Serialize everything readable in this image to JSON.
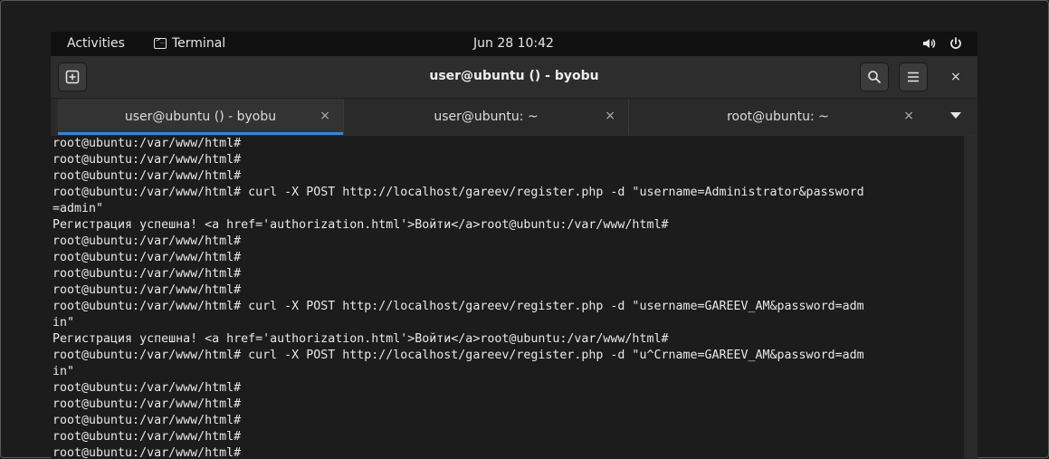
{
  "topbar": {
    "activities": "Activities",
    "app_name": "Terminal",
    "clock": "Jun 28  10:42",
    "icons": {
      "app": "terminal-icon",
      "volume": "volume-icon",
      "power": "power-icon"
    }
  },
  "window": {
    "title": "user@ubuntu () - byobu",
    "buttons": {
      "new_tab": "new-tab-icon",
      "search": "search-icon",
      "menu": "hamburger-menu-icon",
      "close": "×"
    }
  },
  "tabs": [
    {
      "label": "user@ubuntu () - byobu",
      "close": "×",
      "active": true
    },
    {
      "label": "user@ubuntu: ~",
      "close": "×",
      "active": false
    },
    {
      "label": "root@ubuntu: ~",
      "close": "×",
      "active": false
    }
  ],
  "terminal": {
    "lines": [
      "root@ubuntu:/var/www/html#",
      "root@ubuntu:/var/www/html#",
      "root@ubuntu:/var/www/html#",
      "root@ubuntu:/var/www/html# curl -X POST http://localhost/gareev/register.php -d \"username=Administrator&password",
      "=admin\"",
      "Регистрация успешна! <a href='authorization.html'>Войти</a>root@ubuntu:/var/www/html#",
      "root@ubuntu:/var/www/html#",
      "root@ubuntu:/var/www/html#",
      "root@ubuntu:/var/www/html#",
      "root@ubuntu:/var/www/html#",
      "root@ubuntu:/var/www/html# curl -X POST http://localhost/gareev/register.php -d \"username=GAREEV_AM&password=adm",
      "in\"",
      "Регистрация успешна! <a href='authorization.html'>Войти</a>root@ubuntu:/var/www/html#",
      "root@ubuntu:/var/www/html# curl -X POST http://localhost/gareev/register.php -d \"u^Crname=GAREEV_AM&password=adm",
      "in\"",
      "root@ubuntu:/var/www/html#",
      "root@ubuntu:/var/www/html#",
      "root@ubuntu:/var/www/html#",
      "root@ubuntu:/var/www/html#",
      "root@ubuntu:/var/www/html#"
    ]
  },
  "colors": {
    "accent": "#3584e4",
    "terminal_bg": "#1c1c1c",
    "terminal_fg": "#e8e8e8"
  }
}
